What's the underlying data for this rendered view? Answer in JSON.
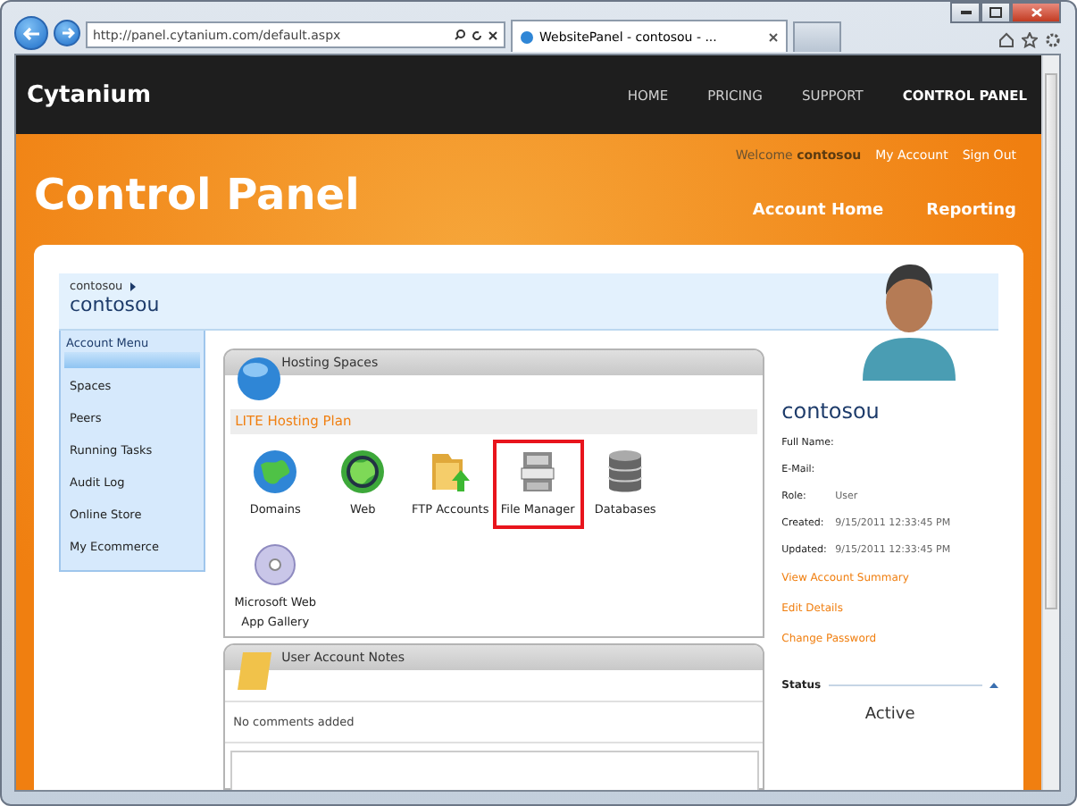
{
  "browser": {
    "address": "http://panel.cytanium.com/default.aspx",
    "tab_title": "WebsitePanel - contosou - ..."
  },
  "site": {
    "brand": "Cytanium",
    "nav": [
      {
        "label": "HOME",
        "selected": false
      },
      {
        "label": "PRICING",
        "selected": false
      },
      {
        "label": "SUPPORT",
        "selected": false
      },
      {
        "label": "CONTROL PANEL",
        "selected": true
      }
    ]
  },
  "banner": {
    "welcome": "Welcome **contosou**",
    "links": [
      "My Account",
      "Sign Out"
    ],
    "title": "Control Panel",
    "nav": [
      "Account Home",
      "Reporting"
    ]
  },
  "account": {
    "breadcrumb": "contosou",
    "name": "contosou"
  },
  "menu": {
    "title": "Account Menu",
    "items": [
      "Spaces",
      "Peers",
      "Running Tasks",
      "Audit Log",
      "Online Store",
      "My Ecommerce"
    ]
  },
  "hosting": {
    "title": "Hosting Spaces",
    "plan": "LITE Hosting Plan",
    "items": [
      {
        "kind": "globe",
        "label": "Domains",
        "highlighted": false
      },
      {
        "kind": "globe-clock",
        "label": "Web",
        "highlighted": false
      },
      {
        "kind": "folder",
        "label": "FTP Accounts",
        "highlighted": false
      },
      {
        "kind": "cabinet",
        "label": "File Manager",
        "highlighted": true
      },
      {
        "kind": "database",
        "label": "Databases",
        "highlighted": false
      },
      {
        "kind": "disc",
        "label": "Microsoft Web App Gallery",
        "highlighted": false
      }
    ]
  },
  "notes": {
    "title": "User Account Notes",
    "empty": "No comments added"
  },
  "profile": {
    "name": "contosou",
    "fields": [
      {
        "label": "Full Name:"
      },
      {
        "label": "E-Mail:"
      },
      {
        "label": "Role:",
        "value": "User"
      },
      {
        "label": "Created:",
        "value": "9/15/2011 12:33:45 PM"
      },
      {
        "label": "Updated:",
        "value": "9/15/2011 12:33:45 PM"
      }
    ],
    "links": [
      "View Account Summary",
      "Edit Details",
      "Change Password"
    ],
    "status": {
      "title": "Status",
      "value": "Active"
    }
  }
}
